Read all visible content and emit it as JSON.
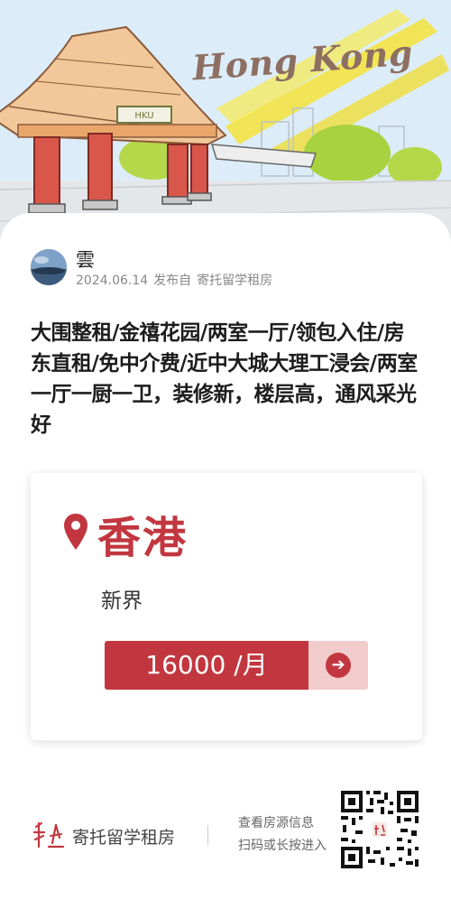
{
  "hero": {
    "title": "Hong Kong",
    "plaque": "HKU"
  },
  "author": {
    "name": "雲",
    "date": "2024.06.14",
    "published_via": "发布自",
    "source": "寄托留学租房"
  },
  "listing": {
    "title": "大围整租/金禧花园/两室一厅/领包入住/房东直租/免中介费/近中大城大理工浸会/两室一厅一厨一卫，装修新，楼层高，通风采光好"
  },
  "location": {
    "city": "香港",
    "district": "新界",
    "price_label": "16000 /月",
    "pin_icon": "location-pin-icon",
    "arrow_icon": "arrow-right-icon"
  },
  "footer": {
    "brand_name": "寄托留学租房",
    "scan_line1": "查看房源信息",
    "scan_line2": "扫码或长按进入",
    "qr_icon": "qr-code-icon"
  },
  "colors": {
    "accent": "#c2373f",
    "accent_light": "#f2cbcc",
    "title_text": "#8d6f62"
  }
}
